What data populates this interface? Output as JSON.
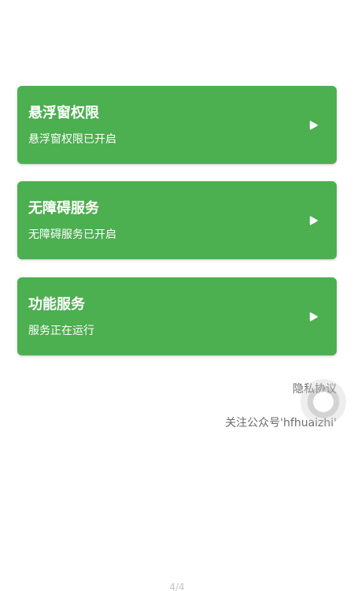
{
  "theme": {
    "card_color": "#4caf50",
    "text_on_card": "#ffffff",
    "muted_text": "#6b6b6b"
  },
  "cards": [
    {
      "title": "悬浮窗权限",
      "subtitle": "悬浮窗权限已开启",
      "icon": "play-arrow-icon"
    },
    {
      "title": "无障碍服务",
      "subtitle": "无障碍服务已开启",
      "icon": "play-arrow-icon"
    },
    {
      "title": "功能服务",
      "subtitle": "服务正在运行",
      "icon": "play-arrow-icon"
    }
  ],
  "footer": {
    "privacy_label": "隐私协议",
    "follow_label": "关注公众号'hfhuaizhi'"
  },
  "floating_ball": {
    "icon": "floating-ball-icon"
  },
  "page_indicator": "4/4"
}
